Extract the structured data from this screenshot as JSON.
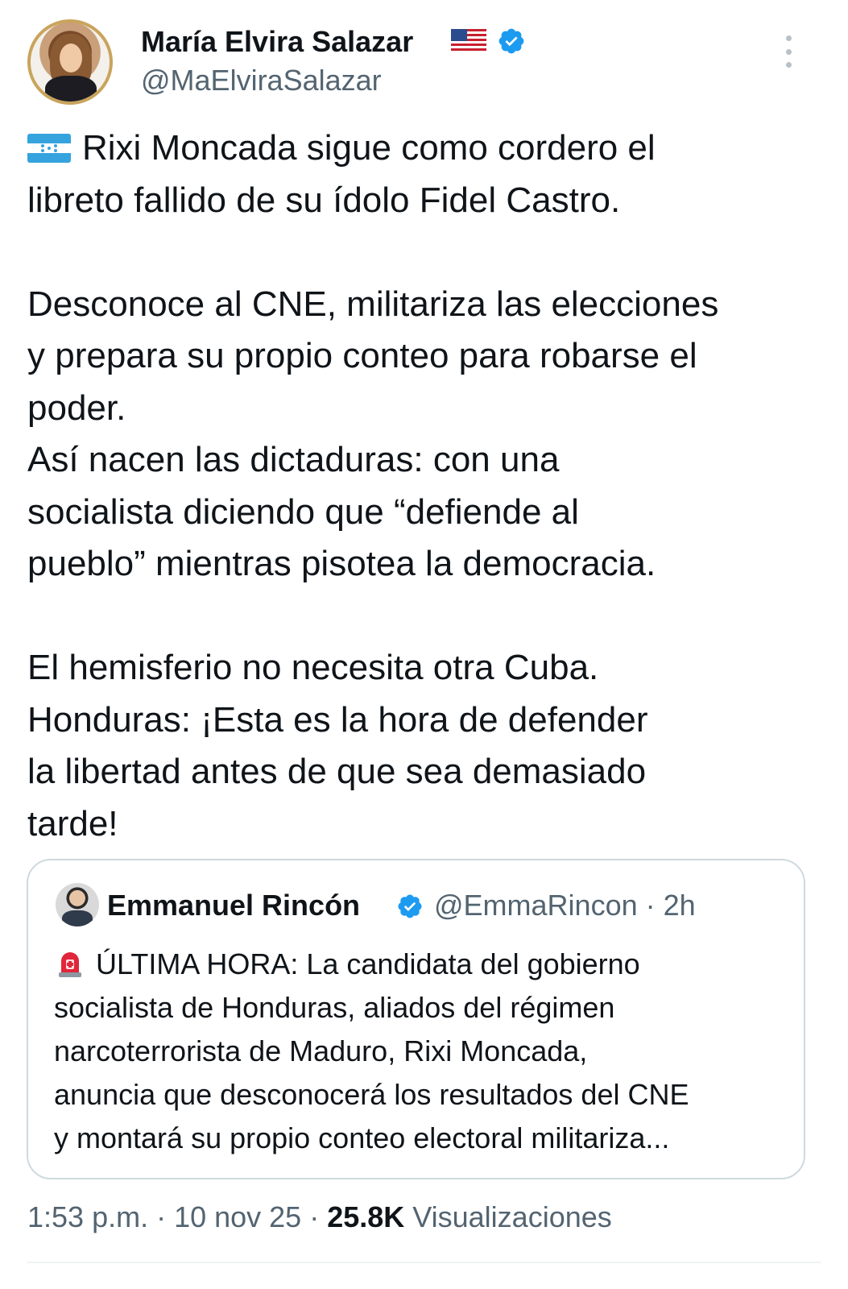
{
  "author": {
    "name": "María Elvira Salazar",
    "handle": "@MaElviraSalazar",
    "flag_icon": "us-flag-icon",
    "verified_color": "#1d9bf0"
  },
  "tweet": {
    "flag_icon": "honduras-flag-icon",
    "lines": [
      "Rixi Moncada sigue como cordero el",
      "libreto fallido de su ídolo Fidel Castro.",
      "Desconoce al CNE, militariza las elecciones",
      "y prepara su propio conteo para robarse el",
      "poder.",
      "Así nacen las dictaduras: con una",
      "socialista diciendo que “defiende al",
      "pueblo” mientras pisotea la democracia.",
      "El hemisferio no necesita otra Cuba.",
      "Honduras: ¡Esta es la hora de defender",
      "la libertad antes de que sea demasiado",
      "tarde!"
    ]
  },
  "quote": {
    "name": "Emmanuel Rincón",
    "meta": "@EmmaRincon · 2h",
    "siren_icon": "rotating-light-icon",
    "lines": [
      "ÚLTIMA HORA: La candidata del gobierno",
      "socialista de Honduras, aliados del régimen",
      "narcoterrorista de Maduro, Rixi Moncada,",
      "anuncia que desconocerá los resultados del CNE",
      "y montará su propio conteo electoral militariza..."
    ]
  },
  "footer": {
    "time_date": "1:53 p.m. · 10 nov 25 · ",
    "views_count": "25.8K",
    "views_label": " Visualizaciones"
  }
}
